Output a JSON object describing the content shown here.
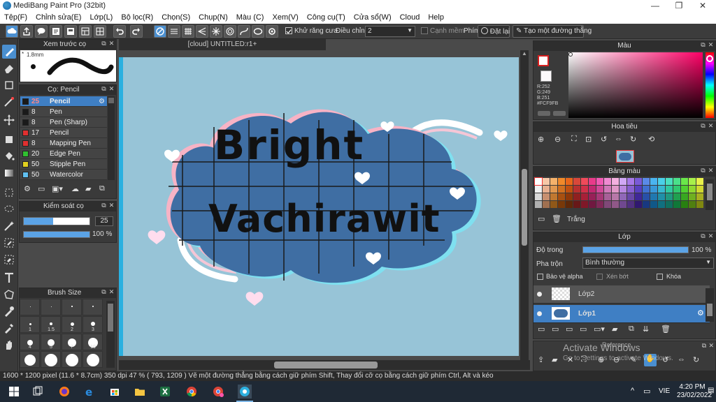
{
  "window": {
    "title": "MediBang Paint Pro (32bit)",
    "minimize": "—",
    "maximize": "❐",
    "close": "✕"
  },
  "menu": [
    "Tệp(F)",
    "Chỉnh sửa(E)",
    "Lớp(L)",
    "Bộ lọc(R)",
    "Chọn(S)",
    "Chụp(N)",
    "Màu (C)",
    "Xem(V)",
    "Công cụ(T)",
    "Cửa sổ(W)",
    "Cloud",
    "Help"
  ],
  "toolbar": {
    "antialias_label": "Khử răng cưa",
    "correction_label": "Điều chỉnh",
    "correction_value": "2",
    "snap_label": "Cạnh mềm",
    "keys_label": "Phím",
    "reset_label": "Đặt lại",
    "create_line_label": "Tạo một đường thẳng"
  },
  "brush_preview": {
    "title": "Xem trước cọ",
    "size": "1.8mm"
  },
  "brush_panel": {
    "title": "Cọ: Pencil",
    "items": [
      {
        "size": "25",
        "name": "Pencil",
        "color": "#1a1a1a"
      },
      {
        "size": "8",
        "name": "Pen",
        "color": "#1a1a1a"
      },
      {
        "size": "8",
        "name": "Pen (Sharp)",
        "color": "#1a1a1a"
      },
      {
        "size": "17",
        "name": "Pencil",
        "color": "#e03030"
      },
      {
        "size": "8",
        "name": "Mapping Pen",
        "color": "#e03030"
      },
      {
        "size": "20",
        "name": "Edge Pen",
        "color": "#30c030"
      },
      {
        "size": "50",
        "name": "Stipple Pen",
        "color": "#e0d020"
      },
      {
        "size": "50",
        "name": "Watercolor",
        "color": "#60c0f0"
      }
    ]
  },
  "brush_control": {
    "title": "Kiểm soát cọ",
    "size_value": "25",
    "size_level": 0.45,
    "opacity_value": "100 %",
    "opacity_level": 1.0
  },
  "brush_size": {
    "title": "Brush Size",
    "labels": [
      "1",
      "1.5",
      "2",
      "3",
      "4",
      "5",
      "7",
      "10"
    ]
  },
  "canvas": {
    "tab": "[cloud] UNTITLED:r1+",
    "line1": "Bright",
    "line2": "Vachirawit"
  },
  "color_panel": {
    "title": "Màu",
    "r": "R:252",
    "g": "G:249",
    "b": "B:251",
    "hex": "#FCF9FB",
    "fg": "#d62020",
    "bg": "#FCF9FB"
  },
  "navigator": {
    "title": "Hoa tiêu"
  },
  "palette": {
    "title": "Bảng màu",
    "name": "Trắng",
    "colors": [
      "#ffffff",
      "#f7c8a8",
      "#f4b26b",
      "#f08a2a",
      "#e8661a",
      "#d8483a",
      "#f04a5a",
      "#e83a8a",
      "#f05ab4",
      "#f08ad2",
      "#f4b0e0",
      "#d0a8f4",
      "#a87ae8",
      "#7a5ad8",
      "#5a8ae8",
      "#4ab4f0",
      "#4ad0e8",
      "#4ae0c0",
      "#4ae08a",
      "#6ae84a",
      "#a8f04a",
      "#e8f04a",
      "#f0f0f0",
      "#e8b090",
      "#e09850",
      "#d07020",
      "#c05010",
      "#b83030",
      "#d03048",
      "#c02870",
      "#d04898",
      "#d078b8",
      "#e098c8",
      "#b888e0",
      "#8860d0",
      "#5840c0",
      "#4070d0",
      "#3898d8",
      "#38b8d0",
      "#30c8a0",
      "#30c870",
      "#50d030",
      "#90d830",
      "#d0d830",
      "#d8d8d8",
      "#c89070",
      "#c07830",
      "#a85010",
      "#903808",
      "#902020",
      "#a82038",
      "#982058",
      "#a83878",
      "#a86098",
      "#b878a8",
      "#9068b8",
      "#6848a8",
      "#402898",
      "#2850a8",
      "#2078b0",
      "#2090a8",
      "#209880",
      "#20a050",
      "#38a820",
      "#70b020",
      "#a8b020",
      "#b0b0b0",
      "#a07050",
      "#905818",
      "#783808",
      "#602808",
      "#681818",
      "#801828",
      "#701840",
      "#802858",
      "#804878",
      "#905888",
      "#704890",
      "#503080",
      "#301870",
      "#183880",
      "#105888",
      "#107080",
      "#107060",
      "#107838",
      "#288010",
      "#508010",
      "#808810",
      "#888888",
      "#785038",
      "#684010",
      "#502808",
      "#401808",
      "#481010",
      "#581020",
      "#501030",
      "#581840",
      "#583058",
      "#684068",
      "#503068",
      "#382058",
      "#201050",
      "#102858",
      "#084060",
      "#085058",
      "#085040",
      "#085828",
      "#185808",
      "#385808",
      "#586008",
      "#606060",
      "#503828",
      "#482808",
      "#381808",
      "#281008",
      "#300808",
      "#380818",
      "#380820",
      "#401030",
      "#402040",
      "#482848",
      "#382048",
      "#281840",
      "#180838",
      "#081840",
      "#082848",
      "#083840",
      "#083030",
      "#084018",
      "#104008",
      "#284008",
      "#404008",
      "#303030",
      "#201810",
      "#201008",
      "#180808",
      "#100808",
      "#180808",
      "#200810",
      "#200810",
      "#200818",
      "#201020",
      "#281828",
      "#201028",
      "#180820",
      "#100820",
      "#081020",
      "#081828",
      "#082020",
      "#081818",
      "#082010",
      "#082008",
      "#182008",
      "#202008"
    ]
  },
  "layer_panel": {
    "title": "Lớp",
    "opacity_label": "Độ trong",
    "opacity_value": "100 %",
    "opacity_level": 1.0,
    "blend_label": "Pha trộn",
    "blend_value": "Bình thường",
    "protect_alpha": "Bảo vệ alpha",
    "clipping": "Xén bớt",
    "lock": "Khóa",
    "layers": [
      "Lớp2",
      "Lớp1"
    ]
  },
  "reference": {
    "title": "Reference",
    "activate_line1": "Activate Windows",
    "activate_line2": "Go to Settings to activate Windows."
  },
  "status": "1600 * 1200 pixel   (11.6 * 8.7cm)   350 dpi   47 %   ( 793, 1209 )   Vẽ một đường thẳng bằng cách giữ phím Shift, Thay đổi cỡ cọ bằng cách giữ phím Ctrl, Alt và kéo",
  "taskbar": {
    "lang": "VIE",
    "time": "4:20 PM",
    "date": "23/02/2022"
  }
}
